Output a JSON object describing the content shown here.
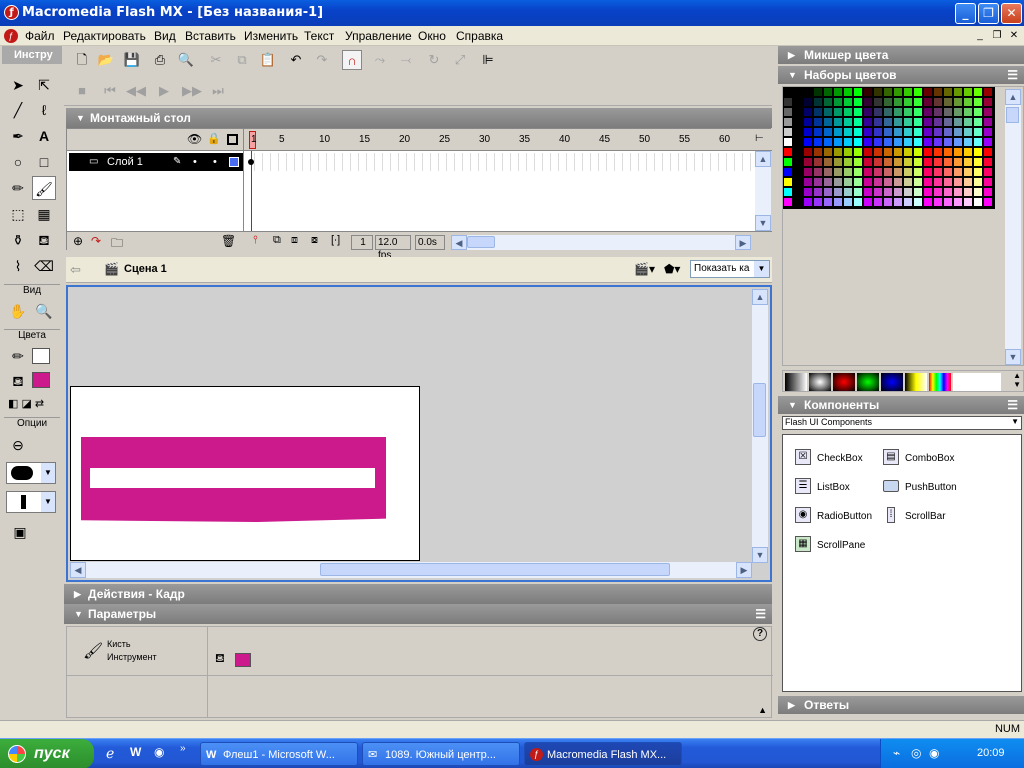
{
  "window": {
    "title": "Macromedia Flash MX - [Без названия-1]"
  },
  "menu": [
    "Файл",
    "Редактировать",
    "Вид",
    "Вставить",
    "Изменить",
    "Текст",
    "Управление",
    "Окно",
    "Справка"
  ],
  "tools_panel": {
    "title": "Инстру",
    "view_label": "Вид",
    "colors_label": "Цвета",
    "options_label": "Опции"
  },
  "timeline": {
    "title": "Монтажный стол",
    "frame_numbers": [
      "1",
      "5",
      "10",
      "15",
      "20",
      "25",
      "30",
      "35",
      "40",
      "45",
      "50",
      "55",
      "60"
    ],
    "layer_name": "Слой 1",
    "current_frame": "1",
    "fps": "12.0 fps",
    "time": "0.0s"
  },
  "scene": {
    "name": "Сцена 1",
    "zoom": "Показать ка"
  },
  "actions_panel": {
    "title": "Действия - Кадр"
  },
  "params_panel": {
    "title": "Параметры",
    "tool_line1": "Кисть",
    "tool_line2": "Инструмент"
  },
  "right": {
    "mixer_title": "Микшер цвета",
    "swatches_title": "Наборы цветов",
    "components_title": "Компоненты",
    "components_select": "Flash UI Components",
    "components": [
      "CheckBox",
      "ComboBox",
      "ListBox",
      "PushButton",
      "RadioButton",
      "ScrollBar",
      "ScrollPane"
    ],
    "answers_title": "Ответы"
  },
  "colors": {
    "fill": "#cc1a8c",
    "accent": "#0a3eb8"
  },
  "status": {
    "num": "NUM"
  },
  "taskbar": {
    "start": "пуск",
    "tasks": [
      "Флеш1 - Microsoft W...",
      "1089. Южный центр...",
      "Macromedia Flash MX..."
    ],
    "lang": "RL",
    "clock": "20:09"
  }
}
